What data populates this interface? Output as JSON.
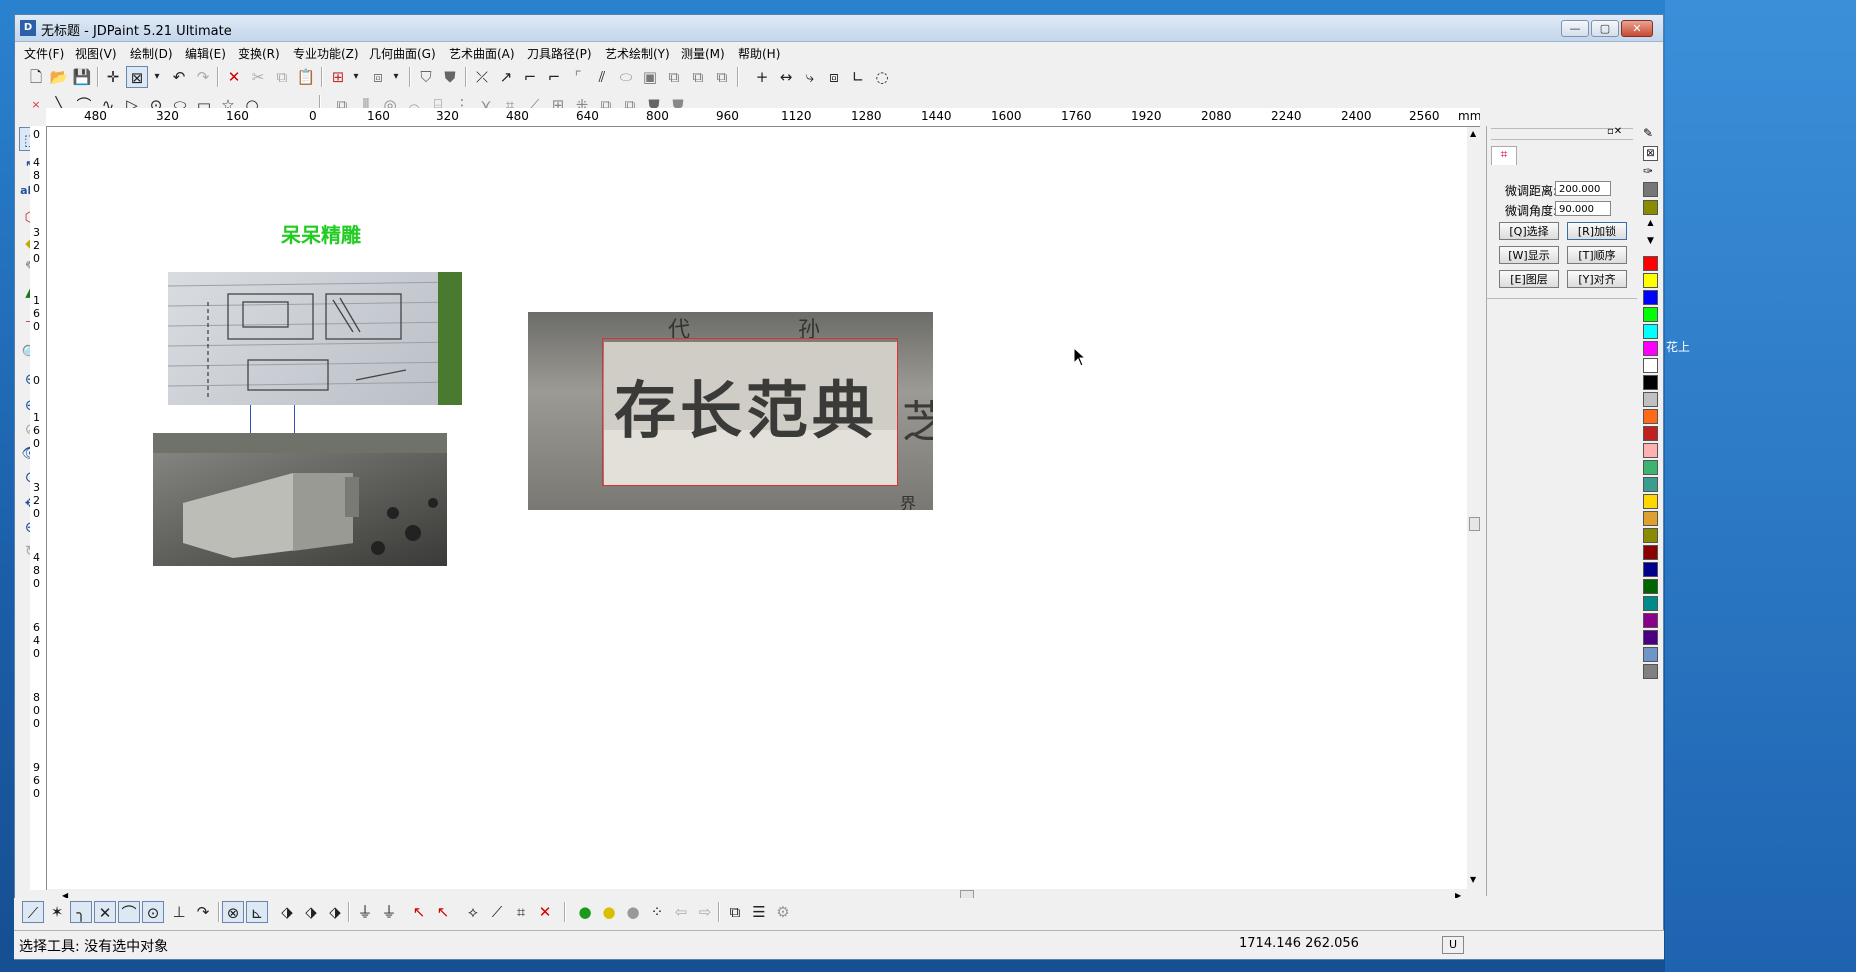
{
  "window": {
    "title": "无标题 - JDPaint 5.21 Ultimate",
    "icon": "app-icon"
  },
  "menu": [
    "文件(F)",
    "视图(V)",
    "绘制(D)",
    "编辑(E)",
    "变换(R)",
    "专业功能(Z)",
    "几何曲面(G)",
    "艺术曲面(A)",
    "刀具路径(P)",
    "艺术绘制(Y)",
    "测量(M)",
    "帮助(H)"
  ],
  "ruler_h": [
    "480",
    "320",
    "160",
    "0",
    "160",
    "320",
    "480",
    "640",
    "800",
    "960",
    "1120",
    "1280",
    "1440",
    "1600",
    "1760",
    "1920",
    "2080",
    "2240",
    "2400",
    "2560",
    "mm"
  ],
  "ruler_v": [
    "0",
    "4 8 0",
    "3 2 0",
    "1 6 0",
    "0",
    "1 6 0",
    "3 2 0",
    "4 8 0",
    "6 4 0",
    "8 0 0",
    "9 6 0"
  ],
  "canvas": {
    "label": "呆呆精雕",
    "label_color": "#22cc22",
    "inscription": "存长范典",
    "top_chars": [
      "代",
      "孙"
    ],
    "side_char": "芝",
    "bottom_char": "界"
  },
  "panel": {
    "fine_distance_label": "微调距离:",
    "fine_distance_value": "200.000",
    "fine_angle_label": "微调角度:",
    "fine_angle_value": "90.000",
    "buttons": [
      "[Q]选择",
      "[R]加锁",
      "[W]显示",
      "[T]顺序",
      "[E]图层",
      "[Y]对齐"
    ]
  },
  "palette": [
    "#ff0000",
    "#ffff00",
    "#0000ff",
    "#00ff00",
    "#00ffff",
    "#ff00ff",
    "#ffffff",
    "#000000",
    "#c0c0c0",
    "#ff6a1a",
    "#c02020",
    "#ffb0b0",
    "#3cb371",
    "#3a9d8f",
    "#ffd700",
    "#e0a030",
    "#8b8b00",
    "#8b0000",
    "#00008b",
    "#006400",
    "#008b8b",
    "#8b008b",
    "#4b0082",
    "#6f94c8",
    "#808080"
  ],
  "status": {
    "text": "选择工具: 没有选中对象",
    "coords": "1714.146  262.056",
    "mode": "U"
  },
  "desktop_label": "花上"
}
